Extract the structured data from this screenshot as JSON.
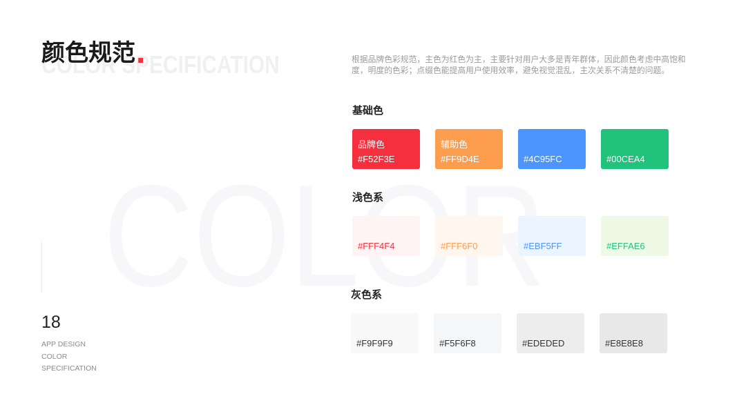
{
  "header": {
    "title": "颜色规范",
    "title_dot": ".",
    "subtitle_en": "COLOR SPECIFICATION",
    "description": "根据品牌色彩规范，主色为红色为主，主要针对用户大多是青年群体，因此颜色考虑中高饱和度，明度的色彩；点缀色能提高用户使用效率，避免视觉混乱，主次关系不清楚的问题。"
  },
  "watermark": "COLOR",
  "sidebar": {
    "page_number": "18",
    "labels": [
      "APP DESIGN",
      "COLOR",
      "SPECIFICATION"
    ]
  },
  "colors": {
    "accent": "#F52F3E"
  },
  "sections": [
    {
      "heading": "基础色",
      "swatches": [
        {
          "name": "品牌色",
          "hex": "#F52F3E",
          "fill": "#F52F3E",
          "text_color": "#FFFFFF"
        },
        {
          "name": "辅助色",
          "hex": "#FF9D4E",
          "fill": "#FF9D4E",
          "text_color": "#FFFFFF"
        },
        {
          "hex": "#4C95FC",
          "fill": "#4C95FC",
          "text_color": "#FFFFFF"
        },
        {
          "hex": "#00CEA4",
          "fill": "#20C27C",
          "text_color": "#FFFFFF"
        }
      ]
    },
    {
      "heading": "浅色系",
      "swatches": [
        {
          "hex": "#FFF4F4",
          "fill": "#FFF4F4",
          "text_color": "#F52F3E"
        },
        {
          "hex": "#FFF6F0",
          "fill": "#FFF6F0",
          "text_color": "#FF9D4E"
        },
        {
          "hex": "#EBF5FF",
          "fill": "#EBF5FF",
          "text_color": "#4C95FC"
        },
        {
          "hex": "#EFFAE6",
          "fill": "#EFFAE6",
          "text_color": "#20C27C"
        }
      ]
    },
    {
      "heading": "灰色系",
      "swatches": [
        {
          "hex": "#F9F9F9",
          "fill": "#F9F9F9",
          "text_color": "#333333"
        },
        {
          "hex": "#F5F6F8",
          "fill": "#F5F6F8",
          "text_color": "#333333"
        },
        {
          "hex": "#EDEDED",
          "fill": "#EDEDED",
          "text_color": "#333333"
        },
        {
          "hex": "#E8E8E8",
          "fill": "#E8E8E8",
          "text_color": "#333333"
        }
      ]
    }
  ]
}
